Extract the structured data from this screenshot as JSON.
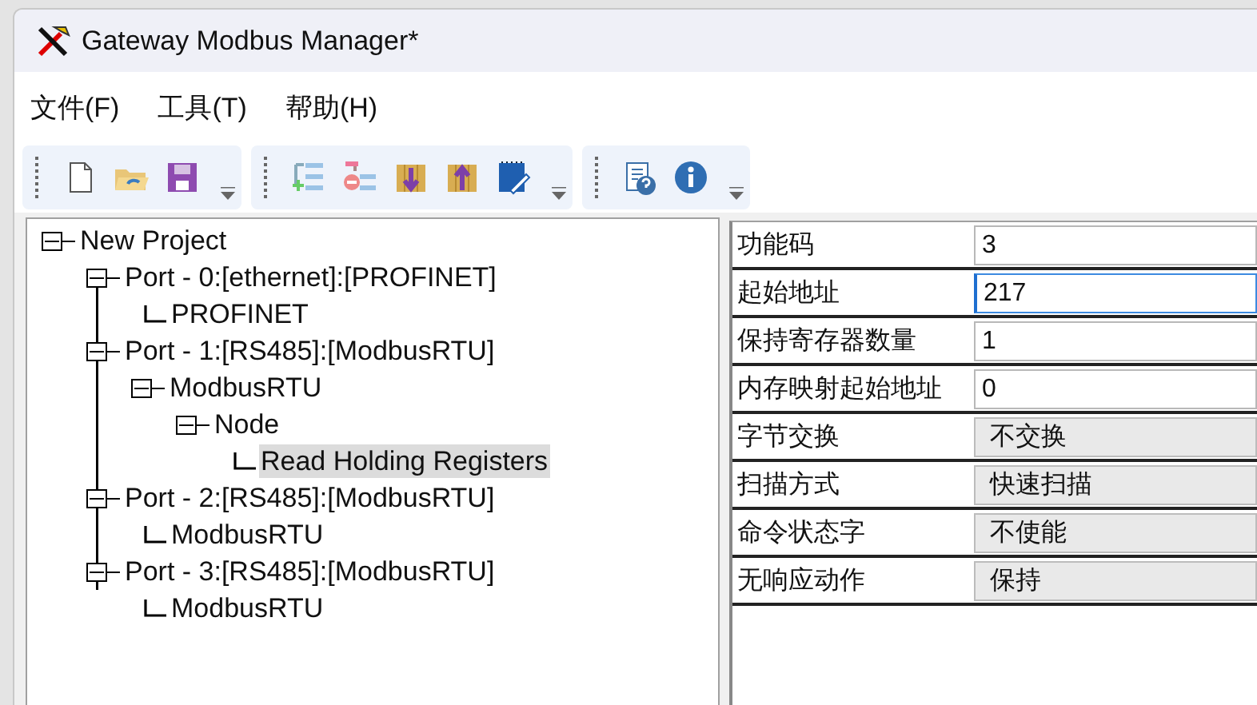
{
  "window": {
    "title": "Gateway Modbus Manager*"
  },
  "menu": [
    {
      "label": "文件(F)"
    },
    {
      "label": "工具(T)"
    },
    {
      "label": "帮助(H)"
    }
  ],
  "tree": [
    {
      "label": "New Project",
      "expanded": true,
      "selected": false,
      "children": [
        {
          "label": "Port - 0:[ethernet]:[PROFINET]",
          "expanded": true,
          "selected": false,
          "children": [
            {
              "label": "PROFINET",
              "selected": false
            }
          ]
        },
        {
          "label": "Port - 1:[RS485]:[ModbusRTU]",
          "expanded": true,
          "selected": false,
          "children": [
            {
              "label": "ModbusRTU",
              "expanded": true,
              "selected": false,
              "children": [
                {
                  "label": "Node",
                  "expanded": true,
                  "selected": false,
                  "children": [
                    {
                      "label": "Read Holding Registers",
                      "selected": true
                    }
                  ]
                }
              ]
            }
          ]
        },
        {
          "label": "Port - 2:[RS485]:[ModbusRTU]",
          "expanded": true,
          "selected": false,
          "children": [
            {
              "label": "ModbusRTU",
              "selected": false
            }
          ]
        },
        {
          "label": "Port - 3:[RS485]:[ModbusRTU]",
          "expanded": true,
          "selected": false,
          "children": [
            {
              "label": "ModbusRTU",
              "selected": false
            }
          ]
        }
      ]
    }
  ],
  "properties": [
    {
      "label": "功能码",
      "kind": "text",
      "value": "3",
      "focused": false
    },
    {
      "label": "起始地址",
      "kind": "text",
      "value": "217",
      "focused": true
    },
    {
      "label": "保持寄存器数量",
      "kind": "text",
      "value": "1",
      "focused": false
    },
    {
      "label": "内存映射起始地址",
      "kind": "text",
      "value": "0",
      "focused": false
    },
    {
      "label": "字节交换",
      "kind": "combo",
      "value": "不交换"
    },
    {
      "label": "扫描方式",
      "kind": "combo",
      "value": "快速扫描"
    },
    {
      "label": "命令状态字",
      "kind": "combo",
      "value": "不使能"
    },
    {
      "label": "无响应动作",
      "kind": "combo",
      "value": "保持"
    }
  ]
}
